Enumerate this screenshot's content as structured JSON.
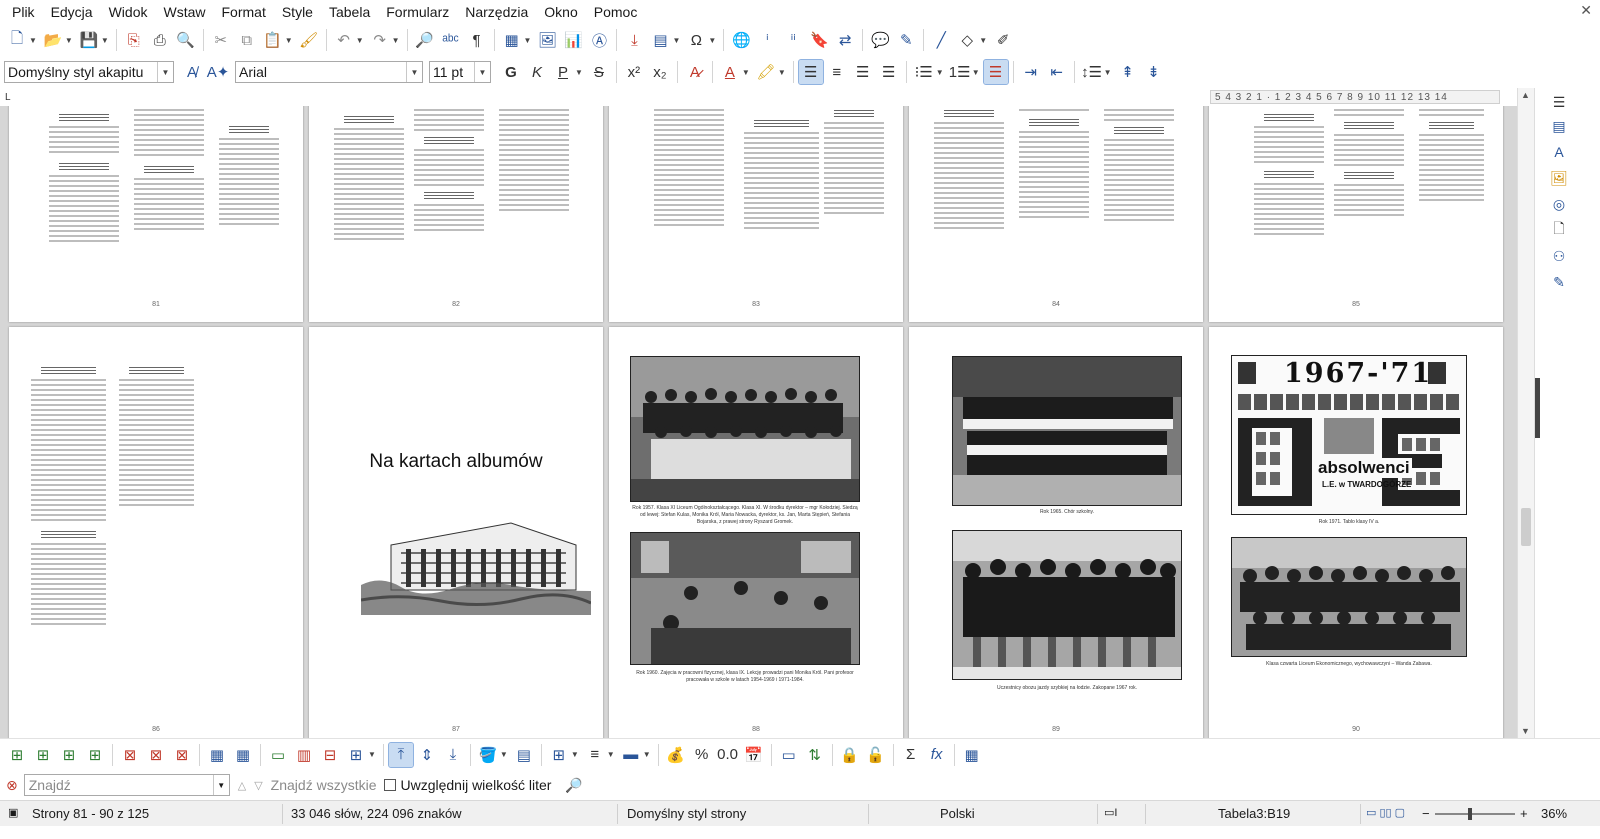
{
  "menu": [
    "Plik",
    "Edycja",
    "Widok",
    "Wstaw",
    "Format",
    "Style",
    "Tabela",
    "Formularz",
    "Narzędzia",
    "Okno",
    "Pomoc"
  ],
  "formatting": {
    "paragraph_style": "Domyślny styl akapitu",
    "font_name": "Arial",
    "font_size": "11 pt",
    "bold": "G",
    "italic": "K",
    "underline": "P",
    "strike": "S"
  },
  "ruler": {
    "corner": "L",
    "marks": "5 4 3 2 1 · 1 2 3 4 5 6 7 8 9 10 11 12 13 14"
  },
  "pages": {
    "page_numbers": [
      "81",
      "82",
      "83",
      "84",
      "85",
      "86",
      "87",
      "88",
      "89",
      "90"
    ],
    "album_title": "Na kartach albumów",
    "captions": {
      "p88_top": "Rok 1957. Klasa XI Liceum Ogólnokształcącego. Klasa XI. W środku dyrektor – mgr Kołodziej. Siedzą od lewej: Stefan Kulas, Monika Król, Maria Nowacka, dyrektor, ks. Jan, Marta Stępień, Stefania Bojarska, z prawej strony Ryszard Gromek.",
      "p88_bottom": "Rok 1960. Zajęcia w pracowni fizycznej, klasa IX. Lekcję prowadzi pani Monika Król. Pani profesor pracowała w szkole w latach 1954-1969 i 1971-1984.",
      "p89_top": "Rok 1965. Chór szkolny.",
      "p89_bottom": "Uczestnicy obozu jazdy szybkiej na łodzie. Zakopane 1967 rok.",
      "p90_top": "Rok 1971. Tablo klasy IV a.",
      "p90_bottom": "Klasa czwarta Liceum Ekonomicznego, wychowawczyni – Wanda Zabawa."
    },
    "tableau": {
      "years": "1967-'71",
      "absolwenci": "absolwenci",
      "school": "L.E. w TWARDOGÓRZE"
    }
  },
  "findbar": {
    "placeholder": "Znajdź",
    "find_all": "Znajdź wszystkie",
    "match_case": "Uwzględnij wielkość liter"
  },
  "status": {
    "pages": "Strony 81 - 90 z 125",
    "words": "33 046 słów, 224 096 znaków",
    "page_style": "Domyślny styl strony",
    "language": "Polski",
    "cell": "Tabela3:B19",
    "zoom": "36%"
  }
}
